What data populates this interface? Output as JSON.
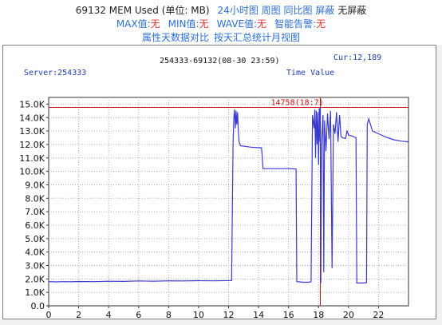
{
  "header": {
    "metric_title": "69132 MEM Used (单位: MB)",
    "links_row1": [
      "24小时图",
      "周图",
      "同比图",
      "屏蔽"
    ],
    "status_row1": "无屏蔽",
    "max_label": "MAX值:",
    "max_value": "无",
    "min_label": "MIN值:",
    "min_value": "无",
    "wave_label": "WAVE值:",
    "wave_value": "无",
    "alarm_label": "智能告警:",
    "alarm_value": "无",
    "links_row3": [
      "属性",
      "天数据对比",
      "按天汇总统计",
      "月视图"
    ]
  },
  "chart_data": {
    "type": "line",
    "title": "254333-69132(08-30 23:59)",
    "server_label": "Server:254333",
    "cur_label": "Cur:12,189",
    "time_label": "Time Value",
    "peak_label": "14758(18:7)",
    "peak_value": 14758,
    "peak_time": 18.12,
    "xlim": [
      0,
      24
    ],
    "ylim": [
      0,
      15500
    ],
    "x_ticks": [
      0,
      2,
      4,
      6,
      8,
      10,
      12,
      14,
      16,
      18,
      20,
      22
    ],
    "x_tick_labels": [
      "0",
      "2",
      "4",
      "6",
      "8",
      "10",
      "12",
      "14",
      "16",
      "18",
      "20",
      "22"
    ],
    "y_ticks": [
      0,
      1000,
      2000,
      3000,
      4000,
      5000,
      6000,
      7000,
      8000,
      9000,
      10000,
      11000,
      12000,
      13000,
      14000,
      15000
    ],
    "y_tick_labels": [
      "0.0",
      "1.0K",
      "2.0K",
      "3.0K",
      "4.0K",
      "5.0K",
      "6.0K",
      "7.0K",
      "8.0K",
      "9.0K",
      "10.0K",
      "11.0K",
      "12.0K",
      "13.0K",
      "14.0K",
      "15.0K"
    ],
    "grid": true,
    "colors": {
      "line": "#3a3ad0",
      "peak": "#d01010",
      "grid": "#b0b0b0",
      "label_blue": "#2040b0"
    },
    "series": [
      {
        "values": [
          [
            0,
            1800
          ],
          [
            0.5,
            1780
          ],
          [
            1,
            1800
          ],
          [
            1.5,
            1790
          ],
          [
            2,
            1810
          ],
          [
            3,
            1800
          ],
          [
            4,
            1830
          ],
          [
            5,
            1820
          ],
          [
            6,
            1850
          ],
          [
            7,
            1830
          ],
          [
            8,
            1860
          ],
          [
            9,
            1850
          ],
          [
            10,
            1870
          ],
          [
            11,
            1860
          ],
          [
            12.2,
            1880
          ],
          [
            12.3,
            12000
          ],
          [
            12.35,
            14000
          ],
          [
            12.4,
            14600
          ],
          [
            12.45,
            13200
          ],
          [
            12.5,
            14500
          ],
          [
            12.55,
            13500
          ],
          [
            12.6,
            14400
          ],
          [
            12.65,
            13000
          ],
          [
            12.7,
            12200
          ],
          [
            12.8,
            11900
          ],
          [
            13.5,
            11800
          ],
          [
            14.2,
            11750
          ],
          [
            14.3,
            10200
          ],
          [
            15,
            10200
          ],
          [
            16,
            10200
          ],
          [
            16.5,
            10180
          ],
          [
            16.55,
            1800
          ],
          [
            17,
            1750
          ],
          [
            17.4,
            1760
          ],
          [
            17.5,
            1800
          ],
          [
            17.6,
            14200
          ],
          [
            17.7,
            13200
          ],
          [
            17.75,
            14600
          ],
          [
            17.8,
            11000
          ],
          [
            17.85,
            14500
          ],
          [
            17.9,
            12000
          ],
          [
            17.95,
            14400
          ],
          [
            18.0,
            10500
          ],
          [
            18.05,
            14700
          ],
          [
            18.1,
            12200
          ],
          [
            18.12,
            14758
          ],
          [
            18.15,
            1700
          ],
          [
            18.2,
            12000
          ],
          [
            18.3,
            14200
          ],
          [
            18.35,
            2500
          ],
          [
            18.4,
            13800
          ],
          [
            18.5,
            11500
          ],
          [
            18.6,
            14300
          ],
          [
            18.7,
            12400
          ],
          [
            18.8,
            14500
          ],
          [
            18.9,
            2800
          ],
          [
            19.0,
            13500
          ],
          [
            19.1,
            12800
          ],
          [
            19.2,
            14400
          ],
          [
            19.3,
            12200
          ],
          [
            19.4,
            14200
          ],
          [
            19.5,
            12600
          ],
          [
            19.6,
            12500
          ],
          [
            19.8,
            12450
          ],
          [
            19.9,
            13000
          ],
          [
            20.0,
            12700
          ],
          [
            20.3,
            12600
          ],
          [
            20.5,
            12500
          ],
          [
            20.55,
            1700
          ],
          [
            21.0,
            1700
          ],
          [
            21.2,
            1720
          ],
          [
            21.25,
            13500
          ],
          [
            21.35,
            13900
          ],
          [
            21.6,
            13000
          ],
          [
            22,
            12800
          ],
          [
            22.5,
            12550
          ],
          [
            23,
            12350
          ],
          [
            23.5,
            12250
          ],
          [
            24,
            12200
          ]
        ]
      }
    ]
  }
}
